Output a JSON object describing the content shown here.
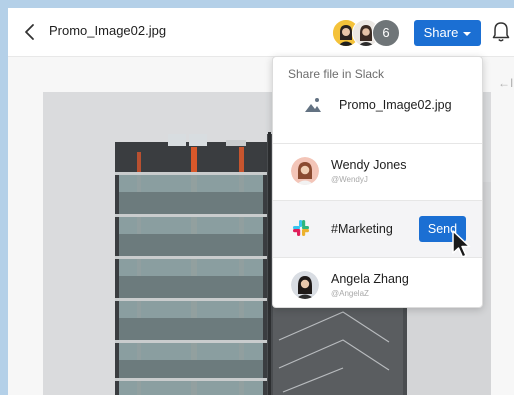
{
  "header": {
    "file_name": "Promo_Image02.jpg",
    "collaborator_count": "6",
    "share_label": "Share"
  },
  "icons": {
    "back": "chevron-left-icon",
    "notifications": "bell-icon",
    "image_file": "image-file-icon",
    "slack": "slack-icon",
    "cursor": "mouse-pointer-icon",
    "collapse": "arrow-left-bar-icon"
  },
  "preview": {
    "collapse_glyph": "←I"
  },
  "popup": {
    "title": "Share file in Slack",
    "file_name": "Promo_Image02.jpg",
    "recipients": [
      {
        "name": "Wendy Jones",
        "handle": "@WendyJ"
      },
      {
        "channel": "#Marketing",
        "action": "Send"
      },
      {
        "name": "Angela Zhang",
        "handle": "@AngelaZ"
      }
    ]
  },
  "colors": {
    "accent": "#1b6fd3",
    "backdrop": "#b4d0e8",
    "avatar_yellow": "#f4c23a"
  }
}
